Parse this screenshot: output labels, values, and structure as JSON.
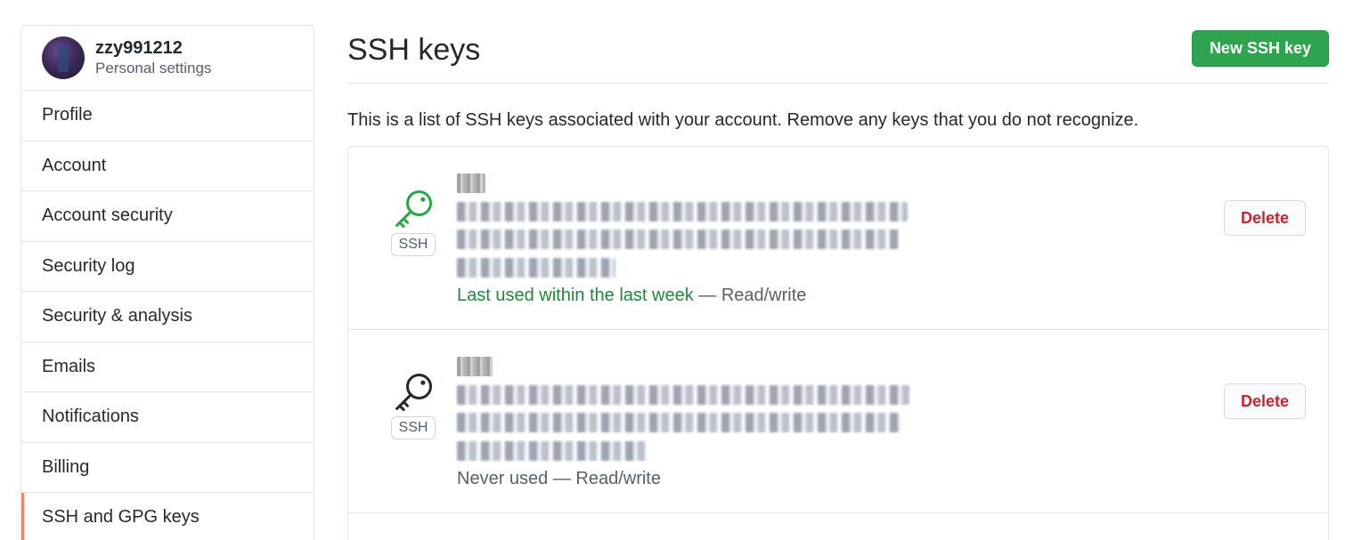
{
  "sidebar": {
    "username": "zzy991212",
    "subtitle": "Personal settings",
    "items": [
      {
        "label": "Profile"
      },
      {
        "label": "Account"
      },
      {
        "label": "Account security"
      },
      {
        "label": "Security log"
      },
      {
        "label": "Security & analysis"
      },
      {
        "label": "Emails"
      },
      {
        "label": "Notifications"
      },
      {
        "label": "Billing"
      },
      {
        "label": "SSH and GPG keys",
        "selected": true
      }
    ]
  },
  "main": {
    "title": "SSH keys",
    "new_key_label": "New SSH key",
    "description": "This is a list of SSH keys associated with your account. Remove any keys that you do not recognize.",
    "keys": [
      {
        "badge": "SSH",
        "icon": "key-icon",
        "icon_color": "#28a745",
        "usage": "Last used within the last week",
        "access": " — Read/write",
        "delete_label": "Delete"
      },
      {
        "badge": "SSH",
        "icon": "key-icon",
        "icon_color": "#24292e",
        "usage": "Never used",
        "access": " — Read/write",
        "delete_label": "Delete"
      }
    ]
  },
  "colors": {
    "primary_button": "#2ea44f",
    "danger_text": "#cb2431",
    "active_nav_accent": "#f9826c",
    "success_text": "#22863a"
  }
}
